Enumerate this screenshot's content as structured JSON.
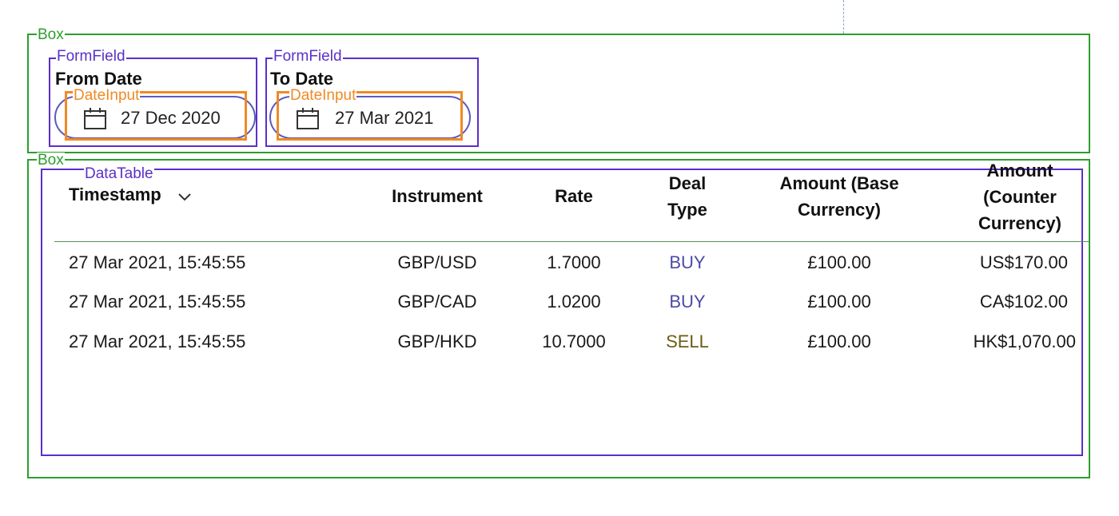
{
  "debug_labels": {
    "box": "Box",
    "form_field": "FormField",
    "date_input": "DateInput",
    "data_table": "DataTable"
  },
  "filters": {
    "from": {
      "label": "From Date",
      "value": "27 Dec 2020"
    },
    "to": {
      "label": "To Date",
      "value": "27 Mar 2021"
    }
  },
  "table": {
    "headers": {
      "timestamp": "Timestamp",
      "instrument": "Instrument",
      "rate": "Rate",
      "deal_type_1": "Deal",
      "deal_type_2": "Type",
      "base_1": "Amount (Base",
      "base_2": "Currency)",
      "counter_1": "Amount",
      "counter_2": "(Counter",
      "counter_3": "Currency)"
    },
    "sort": {
      "column": "timestamp",
      "direction": "descending"
    },
    "rows": [
      {
        "timestamp": "27 Mar 2021, 15:45:55",
        "instrument": "GBP/USD",
        "rate": "1.7000",
        "deal_type": "BUY",
        "base_amount": "£100.00",
        "counter_amount": "US$170.00"
      },
      {
        "timestamp": "27 Mar 2021, 15:45:55",
        "instrument": "GBP/CAD",
        "rate": "1.0200",
        "deal_type": "BUY",
        "base_amount": "£100.00",
        "counter_amount": "CA$102.00"
      },
      {
        "timestamp": "27 Mar 2021, 15:45:55",
        "instrument": "GBP/HKD",
        "rate": "10.7000",
        "deal_type": "SELL",
        "base_amount": "£100.00",
        "counter_amount": "HK$1,070.00"
      }
    ]
  },
  "colors": {
    "box": "#2d9e2d",
    "form_field": "#5b2fc9",
    "date_input": "#f08a24",
    "buy": "#4a4aa8",
    "sell": "#6b5c14"
  }
}
